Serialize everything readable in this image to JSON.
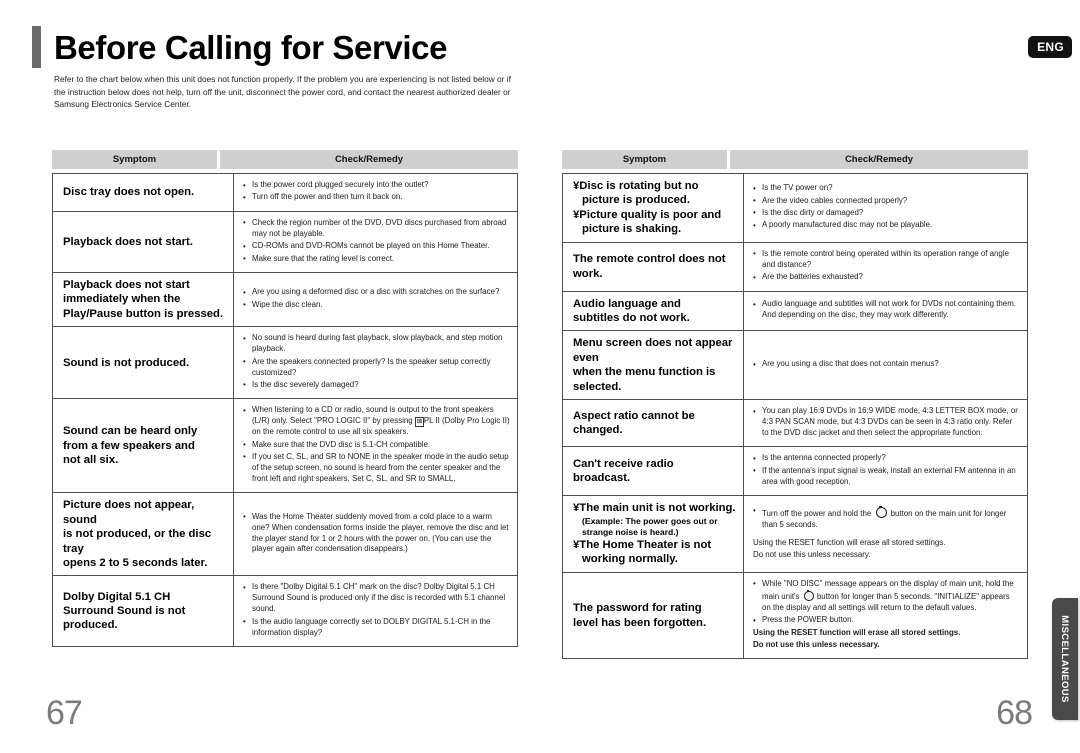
{
  "header": {
    "title": "Before Calling for Service",
    "intro": "Refer to the chart below when this unit does not function properly. If the problem you are experiencing is not listed below or if the instruction below does not help, turn off the unit, disconnect the power cord, and contact the nearest authorized dealer or Samsung Electronics Service Center.",
    "language_badge": "ENG"
  },
  "side_tab": {
    "label": "MISCELLANEOUS"
  },
  "columns": {
    "header_symptom": "Symptom",
    "header_remedy": "Check/Remedy"
  },
  "left_table": {
    "rows": [
      {
        "symptom_lines": [
          "Disc tray does not open."
        ],
        "remedies": [
          "Is the power cord plugged securely into the outlet?",
          "Turn off the power and then turn it back on."
        ]
      },
      {
        "symptom_lines": [
          "Playback does not start."
        ],
        "remedies": [
          "Check the region number of the DVD. DVD discs purchased from abroad may not be playable.",
          "CD-ROMs and DVD-ROMs cannot be played on this Home Theater.",
          "Make sure that the rating level is correct."
        ]
      },
      {
        "symptom_lines": [
          "Playback does not start",
          "immediately when the",
          "Play/Pause button is pressed."
        ],
        "remedies": [
          "Are you using a deformed disc or a disc with scratches on the surface?",
          "Wipe the disc clean."
        ]
      },
      {
        "symptom_lines": [
          "Sound is not produced."
        ],
        "remedies": [
          "No sound is heard during fast playback, slow playback, and step motion playback.",
          "Are the speakers connected properly? Is the speaker setup correctly customized?",
          "Is the disc severely damaged?"
        ]
      },
      {
        "symptom_lines": [
          "Sound can be heard only",
          "from a few speakers and",
          "not all six."
        ],
        "remedies": [
          "When listening to a CD or radio, sound is output to the front speakers (L/R) only. Select \"PRO LOGIC II\" by pressing [DOLBY]PL II (Dolby Pro Logic II) on the remote control to use all six speakers.",
          "Make sure that the DVD disc is 5.1-CH compatible.",
          "If you set C, SL, and SR to NONE in the speaker mode in the audio setup of the setup screen, no sound is heard from the center speaker and the front left and right speakers. Set C, SL, and SR to SMALL."
        ]
      },
      {
        "symptom_lines": [
          "Picture does not appear, sound",
          "is not produced, or the disc tray",
          "opens 2 to 5 seconds later."
        ],
        "remedies": [
          "Was the Home Theater suddenly moved from a cold place to a warm one? When condensation forms inside the player, remove the disc and let the player stand for 1 or 2 hours with the power on. (You can use the player again after condensation disappears.)"
        ]
      },
      {
        "symptom_lines": [
          "Dolby Digital 5.1 CH",
          "Surround Sound is not",
          "produced."
        ],
        "remedies": [
          "Is there \"Dolby Digital 5.1 CH\" mark on the disc? Dolby Digital 5.1 CH Surround Sound is produced only if the disc is recorded with 5.1 channel sound.",
          "Is the audio language correctly set to DOLBY DIGITAL 5.1-CH in the information display?"
        ]
      }
    ]
  },
  "right_table": {
    "rows": [
      {
        "symptom_lines": [
          "¥Disc is rotating but no",
          "picture is produced.",
          "¥Picture quality is poor and",
          "picture is shaking."
        ],
        "remedies": [
          "Is the TV power on?",
          "Are the video cables connected properly?",
          "Is the disc dirty or damaged?",
          "A poorly manufactured disc may not be playable."
        ]
      },
      {
        "symptom_lines": [
          "The remote control does not",
          "work."
        ],
        "remedies": [
          "Is the remote control being operated within its operation range of angle and distance?",
          "Are the batteries exhausted?"
        ]
      },
      {
        "symptom_lines": [
          "Audio language and",
          "subtitles do not work."
        ],
        "remedies": [
          "Audio language and subtitles will not work for DVDs not containing them. And depending on the disc, they may work differently."
        ]
      },
      {
        "symptom_lines": [
          "Menu screen does not appear even",
          "when the menu function is selected."
        ],
        "remedies": [
          "Are you using a disc that does not contain menus?"
        ]
      },
      {
        "symptom_lines": [
          "Aspect ratio cannot be",
          "changed."
        ],
        "remedies": [
          "You can play 16:9 DVDs in 16:9 WIDE mode, 4:3 LETTER BOX mode, or 4:3 PAN SCAN mode, but 4:3 DVDs can be seen in 4:3 ratio only. Refer to the DVD disc jacket and then select the appropriate function."
        ]
      },
      {
        "symptom_lines": [
          "Can't receive radio",
          "broadcast."
        ],
        "remedies": [
          "Is the antenna connected properly?",
          "If the antenna's input signal is weak, install an external FM antenna in an area with good reception."
        ]
      },
      {
        "symptom_lines": [
          "¥The main unit is not working.",
          "(Example: The power goes out or",
          "strange noise is heard.)",
          "¥The Home Theater is not",
          "working normally."
        ],
        "remedies_part1_before_icon": "Turn off the power and hold the",
        "remedies_part1_after_icon": "button on the main unit for longer than 5 seconds.",
        "note_line1": "Using the RESET function will erase all stored settings.",
        "note_line2": "Do not use this unless necessary."
      },
      {
        "symptom_lines": [
          "The password for rating",
          "level has been forgotten."
        ],
        "remedy_before_icon": "While \"NO DISC\" message appears on the display of main unit, hold the main unit's",
        "remedy_after_icon": "button for longer than 5 seconds. \"INITIALIZE\" appears on the display and all settings will return to the default values.",
        "remedy2": "Press the POWER button.",
        "note_line1": "Using the RESET function will erase all stored settings.",
        "note_line2": "Do not use this unless necessary."
      }
    ]
  },
  "footer": {
    "page_left": "67",
    "page_right": "68"
  }
}
